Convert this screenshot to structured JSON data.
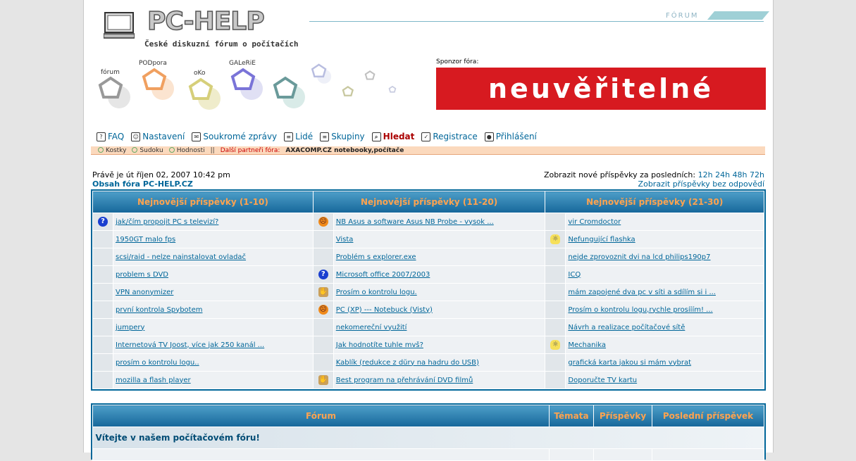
{
  "header": {
    "logo_title": "PC-HELP",
    "logo_subtitle": "České diskuzní fórum o počítačích",
    "forum_tag": "FÓRUM",
    "nav": [
      {
        "label": "fórum",
        "color": "#9a9a9a"
      },
      {
        "label": "PODpora",
        "color": "#f0a060"
      },
      {
        "label": "oKo",
        "color": "#d6cf7a"
      },
      {
        "label": "GALeRiE",
        "color": "#7a74d8"
      }
    ],
    "sponsor_label": "Sponzor fóra:",
    "sponsor_text": "neuvěřitelné"
  },
  "menu": {
    "items": [
      {
        "label": "FAQ",
        "icon": "question-icon"
      },
      {
        "label": "Nastavení",
        "icon": "user-icon"
      },
      {
        "label": "Soukromé zprávy",
        "icon": "mail-icon"
      },
      {
        "label": "Lidé",
        "icon": "list-icon"
      },
      {
        "label": "Skupiny",
        "icon": "group-icon"
      },
      {
        "label": "Hledat",
        "icon": "search-icon"
      },
      {
        "label": "Registrace",
        "icon": "check-icon"
      },
      {
        "label": "Přihlášení",
        "icon": "login-icon"
      }
    ]
  },
  "subbar": {
    "links": [
      "Kostky",
      "Sudoku",
      "Hodnosti"
    ],
    "separator": "||",
    "partners_label": "Další partneři fóra:",
    "partner": "AXACOMP.CZ notebooky,počítače"
  },
  "info": {
    "date": "Právě je út říjen 02, 2007 10:42 pm",
    "index_link": "Obsah fóra PC-HELP.CZ",
    "newposts_label": "Zobrazit nové příspěvky za posledních:",
    "newposts_ranges": [
      "12h",
      "24h",
      "48h",
      "72h"
    ],
    "unanswered": "Zobrazit příspěvky bez odpovědí"
  },
  "latest": {
    "headers": [
      "Nejnovější příspěvky (1-10)",
      "Nejnovější příspěvky (11-20)",
      "Nejnovější příspěvky (21-30)"
    ],
    "rows": [
      [
        {
          "icon": "question",
          "text": "jak/čím propojit PC s televizí?"
        },
        {
          "icon": "sad",
          "text": "NB Asus a software Asus NB Probe - vysok ..."
        },
        {
          "icon": "",
          "text": "vir Cromdoctor"
        }
      ],
      [
        {
          "icon": "",
          "text": "1950GT malo fps"
        },
        {
          "icon": "",
          "text": "Vista"
        },
        {
          "icon": "bulb",
          "text": "Nefungující flashka"
        }
      ],
      [
        {
          "icon": "",
          "text": "scsi/raid - nelze nainstalovat ovladač"
        },
        {
          "icon": "",
          "text": "Problém s explorer.exe"
        },
        {
          "icon": "",
          "text": "nejde zprovoznit dvi na lcd philips190p7"
        }
      ],
      [
        {
          "icon": "",
          "text": "problem s DVD"
        },
        {
          "icon": "question",
          "text": "Microsoft office 2007/2003"
        },
        {
          "icon": "",
          "text": "ICQ"
        }
      ],
      [
        {
          "icon": "",
          "text": "VPN anonymizer"
        },
        {
          "icon": "thumbdown",
          "text": "Prosím o kontrolu logu."
        },
        {
          "icon": "",
          "text": "mám zapojené dva pc v síti a sdílím si i ..."
        }
      ],
      [
        {
          "icon": "",
          "text": "první kontrola Spybotem"
        },
        {
          "icon": "sad",
          "text": "PC (XP) --- Notebuck (Visty)"
        },
        {
          "icon": "",
          "text": "Prosím o kontrolu logu,rychle prosííím! ..."
        }
      ],
      [
        {
          "icon": "",
          "text": "jumpery"
        },
        {
          "icon": "",
          "text": "nekomereční využití"
        },
        {
          "icon": "",
          "text": "Návrh a realizace počítačové sítě"
        }
      ],
      [
        {
          "icon": "",
          "text": "Internetová TV Joost, více jak 250 kanál ..."
        },
        {
          "icon": "",
          "text": "Jak hodnotíte tuhle mvš?"
        },
        {
          "icon": "bulb",
          "text": "Mechanika"
        }
      ],
      [
        {
          "icon": "",
          "text": "prosím o kontrolu logu.."
        },
        {
          "icon": "",
          "text": "Kablík (redukce z dŭry na hadru do USB)"
        },
        {
          "icon": "",
          "text": "grafická karta jakou si mám vybrat"
        }
      ],
      [
        {
          "icon": "",
          "text": "mozilla a flash player"
        },
        {
          "icon": "thumbup",
          "text": "Best program na přehrávání DVD filmů"
        },
        {
          "icon": "",
          "text": "Doporučte TV kartu"
        }
      ]
    ]
  },
  "forum": {
    "headers": [
      "Fórum",
      "Témata",
      "Příspěvky",
      "Poslední příspěvek"
    ],
    "welcome": "Vítejte v našem počítačovém fóru!"
  }
}
